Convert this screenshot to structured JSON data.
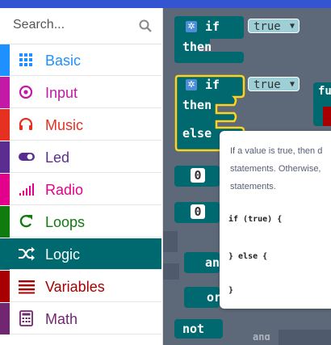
{
  "search": {
    "placeholder": "Search..."
  },
  "toolbox": {
    "categories": [
      {
        "label": "Basic",
        "color": "#1e90ff",
        "icon": "grid-icon"
      },
      {
        "label": "Input",
        "color": "#c219a6",
        "icon": "target-icon"
      },
      {
        "label": "Music",
        "color": "#e63022",
        "icon": "headphones-icon"
      },
      {
        "label": "Led",
        "color": "#5c2d91",
        "icon": "toggle-icon"
      },
      {
        "label": "Radio",
        "color": "#e3008c",
        "icon": "signal-bars-icon"
      },
      {
        "label": "Loops",
        "color": "#107c10",
        "icon": "loop-arrow-icon"
      },
      {
        "label": "Logic",
        "color": "#006970",
        "icon": "shuffle-icon",
        "selected": true
      },
      {
        "label": "Variables",
        "color": "#a80000",
        "icon": "list-lines-icon"
      },
      {
        "label": "Math",
        "color": "#712672",
        "icon": "calculator-icon"
      }
    ]
  },
  "blocks": {
    "if_then": {
      "if": "if",
      "then": "then",
      "value": "true"
    },
    "if_then_else": {
      "if": "if",
      "then": "then",
      "else": "else",
      "value": "true"
    },
    "num1": "0",
    "num2": "0",
    "and": "an",
    "or": "or",
    "not": "not",
    "partial_fu": "fu",
    "and_bottom": "and"
  },
  "tooltip": {
    "line1": "If a value is true, then d",
    "line2": "statements. Otherwise,",
    "line3": "statements.",
    "code1": "if (true) {",
    "code2": "} else {",
    "code3": "}"
  }
}
